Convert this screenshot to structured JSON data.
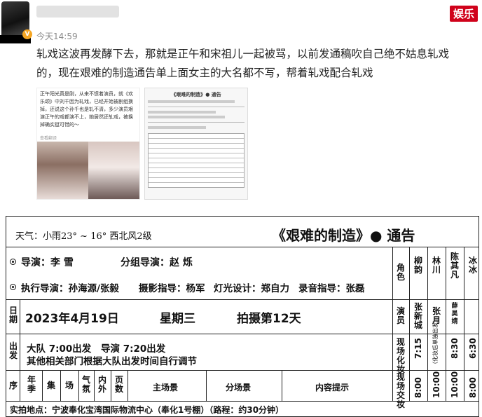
{
  "post": {
    "time": "今天14:59",
    "brand": "娱乐",
    "text_line1": "轧戏这波再发酵下去，那就是正午和宋祖儿一起被骂，以前发通稿吹自己绝不姑息轧戏",
    "text_line2": "的，现在艰难的制造通告单上面女主的大名都不写，帮着轧戏配合轧戏"
  },
  "thumb1": {
    "text": "正午阳光真是刚，从来不惯着演员，就《欢乐颂》中刘千因为轧戏，已经开始被剧组换掉，还说这个孙千也是轧不清，多少演员艰演正午的戏都演不上，她居然还轧戏，被换掉确实挺可惜的～",
    "source": "查看翻译"
  },
  "thumb2": {
    "title": "《艰难的制造》● 通告"
  },
  "call_sheet": {
    "weather": "天气：小雨23° ~ 16° 西北风2级",
    "title": "《艰难的制造》● 通告",
    "director_label": "导演：李 雪",
    "unit_director_label": "分组导演：赵 烁",
    "exec_director": "执行导演：孙海源/张毅",
    "photo_director": "摄影指导：杨军",
    "lighting": "灯光设计：郑自力",
    "sound": "录音指导：张磊",
    "date_label": "日期",
    "date": "2023年4月19日",
    "weekday": "星期三",
    "shoot_day": "拍摄第12天",
    "depart_label": "出发",
    "main_team": "大队 7:00出发",
    "director_depart": "导演 7:20出发",
    "depart_note": "其他相关部门根据大队出发时间自行调节",
    "columns": [
      "序",
      "年季",
      "集",
      "场",
      "气氛",
      "内外",
      "页数",
      "主场景",
      "分场景",
      "内容提示"
    ],
    "role_label": "角色",
    "actor_label": "演员",
    "makeup_label": "现场化妆",
    "wardrobe_label": "现场交妆",
    "cast": [
      {
        "role": "柳韵",
        "actor": "张新城",
        "makeup": "7:15",
        "arrive": "8:00"
      },
      {
        "role": "林川",
        "actor": "张月",
        "makeup": "（化妆后单独出发）",
        "arrive": "10:00"
      },
      {
        "role": "陈其凡",
        "actor": "薛昊婧",
        "makeup": "8:30",
        "arrive": "10:00"
      },
      {
        "role": "冰冰",
        "actor": "",
        "makeup": "6:30",
        "arrive": "8:00"
      }
    ],
    "location": "实拍地点：宁波奉化宝湾国际物流中心（奉化1号棚）（路程：约30分钟）"
  }
}
